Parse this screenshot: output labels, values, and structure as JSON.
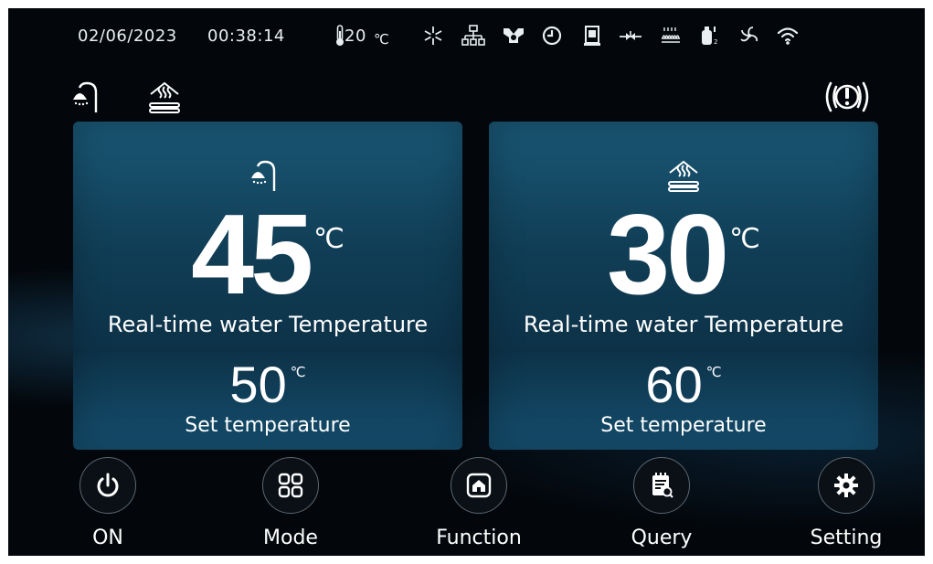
{
  "status_bar": {
    "date": "02/06/2023",
    "time": "00:38:14",
    "ambient_temp": "20",
    "ambient_unit": "℃",
    "icons": [
      "snowflake-defrost-icon",
      "network-icon",
      "pump-icon",
      "timer-icon",
      "water-tank-icon",
      "valve-icon",
      "heater-icon",
      "compressor-icon",
      "fan-icon",
      "wifi-icon"
    ]
  },
  "top_icons": [
    "shower-icon",
    "floor-heating-icon"
  ],
  "alarm_icon": "alarm-icon",
  "cards": [
    {
      "icon": "shower-icon",
      "realtime_value": "45",
      "realtime_unit": "℃",
      "realtime_label": "Real-time water Temperature",
      "set_value": "50",
      "set_unit": "℃",
      "set_label": "Set temperature"
    },
    {
      "icon": "floor-heating-icon",
      "realtime_value": "30",
      "realtime_unit": "℃",
      "realtime_label": "Real-time water Temperature",
      "set_value": "60",
      "set_unit": "℃",
      "set_label": "Set temperature"
    }
  ],
  "nav": [
    {
      "label": "ON",
      "icon": "power-icon"
    },
    {
      "label": "Mode",
      "icon": "grid-icon"
    },
    {
      "label": "Function",
      "icon": "home-icon"
    },
    {
      "label": "Query",
      "icon": "calendar-search-icon"
    },
    {
      "label": "Setting",
      "icon": "gear-icon"
    }
  ],
  "colors": {
    "background": "#03070c",
    "card_top": "#1a5775",
    "card_bottom": "#154f6f",
    "text": "#ffffff"
  }
}
